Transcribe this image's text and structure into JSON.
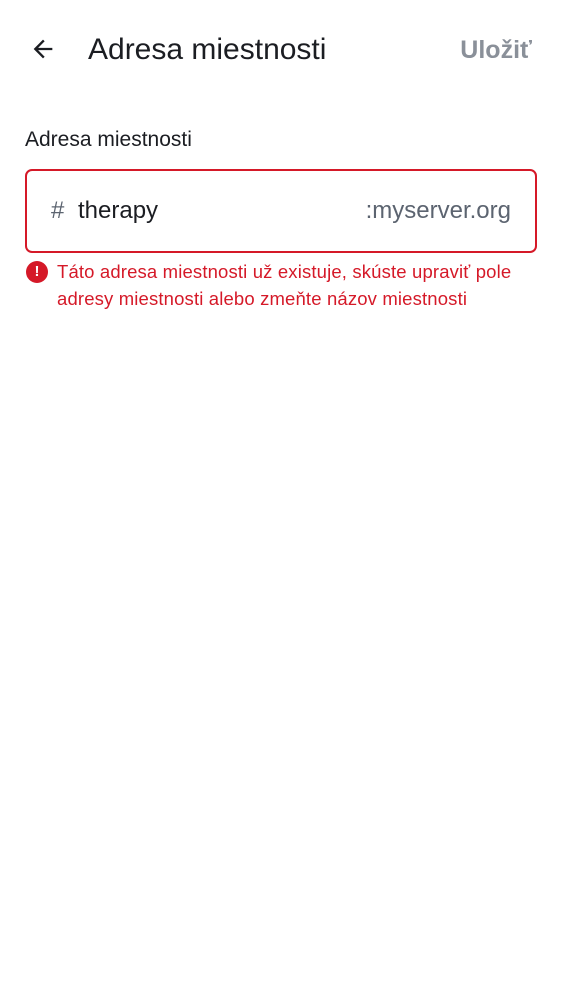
{
  "header": {
    "back_icon": "arrow-left-icon",
    "title": "Adresa miestnosti",
    "save_label": "Uložiť"
  },
  "form": {
    "label": "Adresa miestnosti",
    "prefix": "#",
    "alias_value": "therapy",
    "suffix": ":myserver.org",
    "error_icon": "error-icon",
    "error_icon_glyph": "!",
    "error_message": "Táto adresa miestnosti už existuje, skúste upraviť pole adresy miestnosti alebo zmeňte názov miestnosti"
  },
  "colors": {
    "error": "#d51928",
    "disabled_action": "#8a9099",
    "text_primary": "#1b1d22",
    "text_secondary": "#5c6470"
  }
}
